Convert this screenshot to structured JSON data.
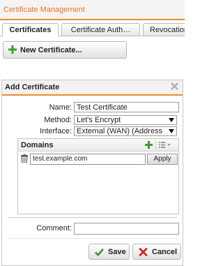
{
  "app": {
    "title": "Certificate Management"
  },
  "tabs": [
    {
      "label": "Certificates",
      "active": true
    },
    {
      "label": "Certificate Auth…",
      "active": false
    },
    {
      "label": "Revocation",
      "active": false
    }
  ],
  "toolbar": {
    "new_certificate_label": "New Certificate...",
    "new_certificate_icon": "plus-icon"
  },
  "dialog": {
    "title": "Add Certificate",
    "close_icon": "close-icon",
    "fields": {
      "name_label": "Name:",
      "name_value": "Test Certificate",
      "method_label": "Method:",
      "method_value": "Let's Encrypt",
      "interface_label": "Interface:",
      "interface_value": "External (WAN) (Address",
      "comment_label": "Comment:",
      "comment_value": ""
    },
    "domains": {
      "title": "Domains",
      "add_icon": "plus-icon",
      "menu_icon": "list-menu-icon",
      "items": [
        {
          "value": "test.example.com",
          "apply_label": "Apply",
          "delete_icon": "trash-icon"
        }
      ]
    },
    "buttons": {
      "save_label": "Save",
      "save_icon": "checkmark-icon",
      "cancel_label": "Cancel",
      "cancel_icon": "x-icon"
    }
  },
  "colors": {
    "accent": "#ee8a2a",
    "title_text": "#e8741f",
    "green_icon": "#3f9b2f",
    "red_icon": "#cc2a2a"
  }
}
